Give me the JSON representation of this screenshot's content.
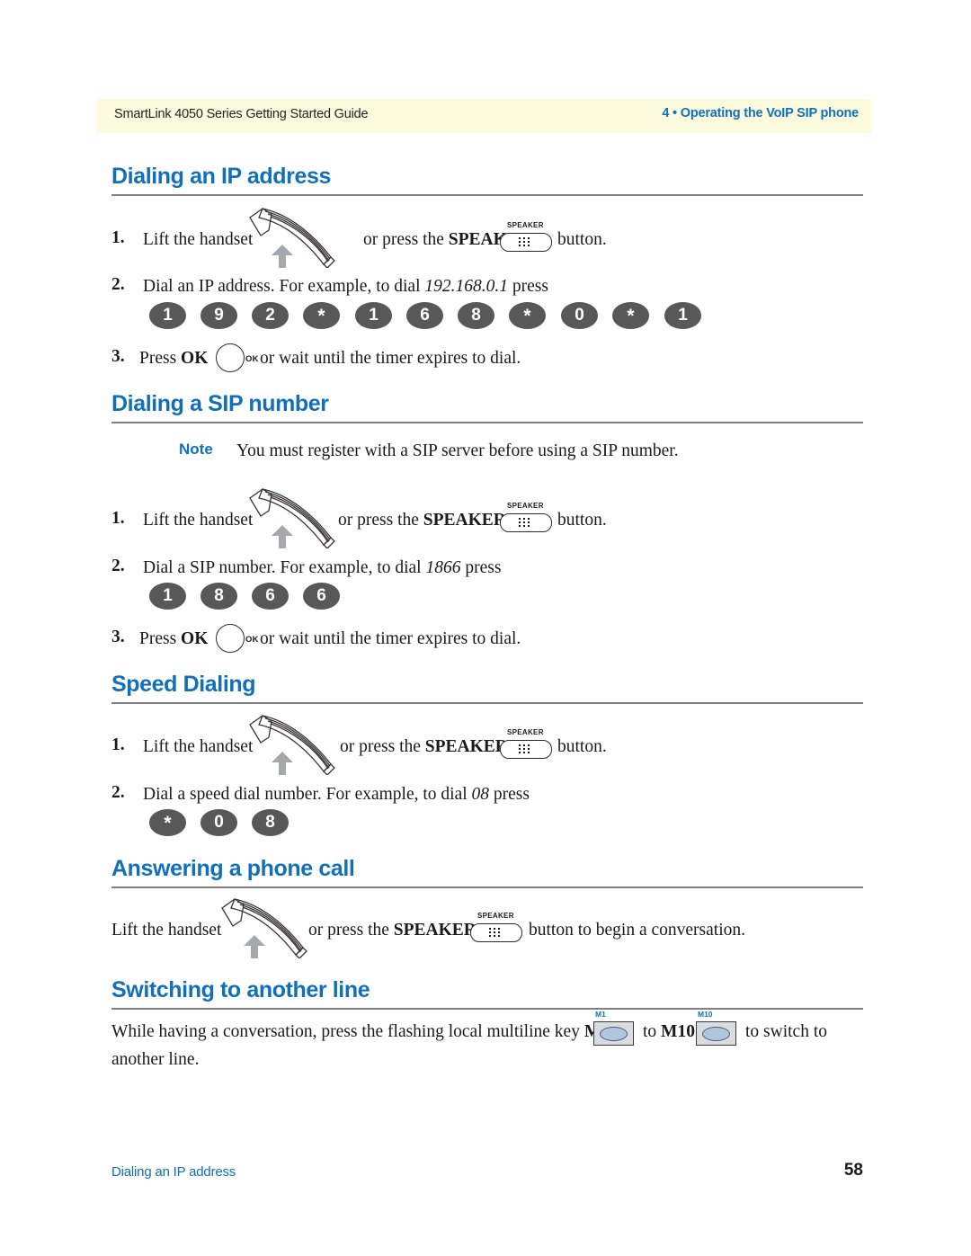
{
  "header": {
    "left_text": "SmartLink 4050 Series Getting Started Guide",
    "right_text": "4 • Operating the VoIP SIP phone"
  },
  "icons": {
    "handset": "handset-icon",
    "speaker": "speaker-button-icon",
    "speaker_caption": "SPEAKER",
    "ok": "ok-button-icon",
    "ok_caption": "OK",
    "up_arrow": "up-arrow-icon"
  },
  "sections": [
    {
      "heading": "Dialing an IP address",
      "steps": [
        {
          "num": "1.",
          "text_before": "Lift the handset",
          "text_middle": "or press the ",
          "bold_word": "SPEAKER",
          "text_after": "button."
        },
        {
          "num": "2.",
          "text_before": "Dial an IP address. For example, to dial ",
          "italic_value": "192.168.0.1",
          "text_after": " press",
          "keys": [
            "1",
            "9",
            "2",
            "*",
            "1",
            "6",
            "8",
            "*",
            "0",
            "*",
            "1"
          ]
        },
        {
          "num": "3.",
          "text_before": "Press ",
          "bold_word": "OK",
          "text_after": "or wait until the timer expires to dial."
        }
      ]
    },
    {
      "heading": "Dialing a SIP number",
      "note": {
        "label": "Note",
        "text": "You must register with a SIP server before using a SIP number."
      },
      "steps": [
        {
          "num": "1.",
          "text_before": "Lift the handset",
          "text_middle": "or press the ",
          "bold_word": "SPEAKER",
          "text_after": "button."
        },
        {
          "num": "2.",
          "text_before": "Dial a SIP number. For example, to dial ",
          "italic_value": "1866",
          "text_after": " press",
          "keys": [
            "1",
            "8",
            "6",
            "6"
          ]
        },
        {
          "num": "3.",
          "text_before": "Press ",
          "bold_word": "OK",
          "text_after": "or wait until the timer expires to dial."
        }
      ]
    },
    {
      "heading": "Speed Dialing",
      "steps": [
        {
          "num": "1.",
          "text_before": "Lift the handset",
          "text_middle": "or press the ",
          "bold_word": "SPEAKER",
          "text_after": "button."
        },
        {
          "num": "2.",
          "text_before": "Dial a speed dial number. For example, to dial ",
          "italic_value": "08",
          "text_after": " press",
          "keys": [
            "*",
            "0",
            "8"
          ]
        }
      ]
    },
    {
      "heading": "Answering a phone call",
      "paragraph": {
        "text_before": "Lift the handset",
        "text_middle": "or press the ",
        "bold_word": "SPEAKER",
        "text_after": "button to begin a conversation."
      }
    },
    {
      "heading": "Switching to another line",
      "paragraph": {
        "text_before": "While having a conversation, press the flashing local multiline key ",
        "bold_key_1": "M1",
        "text_middle": "to ",
        "bold_key_2": "M10",
        "text_after": "to switch to",
        "text_line2": "another line."
      },
      "mkeys": [
        {
          "label": "M1"
        },
        {
          "label": "M10"
        }
      ]
    }
  ],
  "footer": {
    "left_text": "Dialing an IP address",
    "page_number": "58"
  },
  "colors": {
    "heading_blue": "#1270b8",
    "header_band": "#fcfbdd",
    "key_gray": "#585858",
    "rule_gray": "#808080"
  }
}
